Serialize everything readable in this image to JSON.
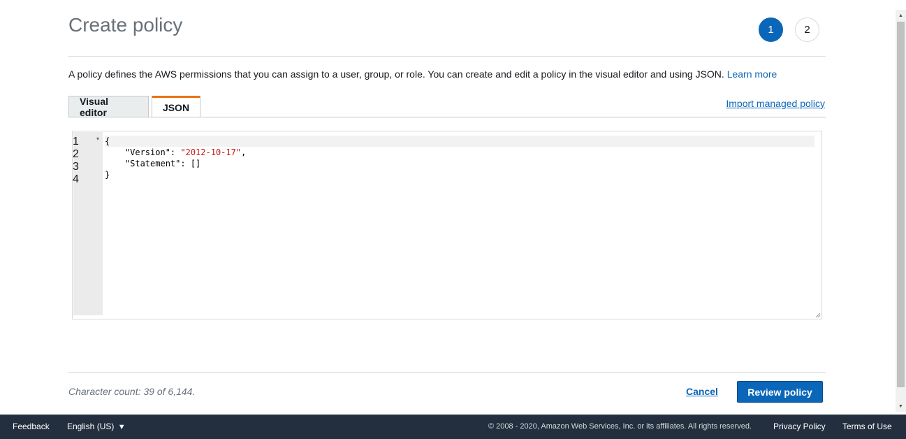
{
  "header": {
    "title": "Create policy",
    "steps": [
      "1",
      "2"
    ]
  },
  "description": {
    "text": "A policy defines the AWS permissions that you can assign to a user, group, or role. You can create and edit a policy in the visual editor and using JSON. ",
    "link": "Learn more"
  },
  "tabs": {
    "visual": "Visual editor",
    "json": "JSON",
    "active": "JSON"
  },
  "import_link": "Import managed policy",
  "editor": {
    "line_numbers": [
      "1",
      "2",
      "3",
      "4"
    ],
    "lines": {
      "l1": "{",
      "l2_key": "    \"Version\": ",
      "l2_val": "\"2012-10-17\"",
      "l2_end": ",",
      "l3": "    \"Statement\": []",
      "l4": "}"
    }
  },
  "bottom": {
    "char_count": "Character count: 39 of 6,144.",
    "cancel": "Cancel",
    "review": "Review policy"
  },
  "footer": {
    "feedback": "Feedback",
    "language": "English (US)",
    "copyright": "© 2008 - 2020, Amazon Web Services, Inc. or its affiliates. All rights reserved.",
    "privacy": "Privacy Policy",
    "terms": "Terms of Use"
  },
  "colors": {
    "primary": "#0a66b8",
    "tab_accent": "#ec7211",
    "footer_bg": "#232f3e",
    "string": "#c41a16"
  }
}
